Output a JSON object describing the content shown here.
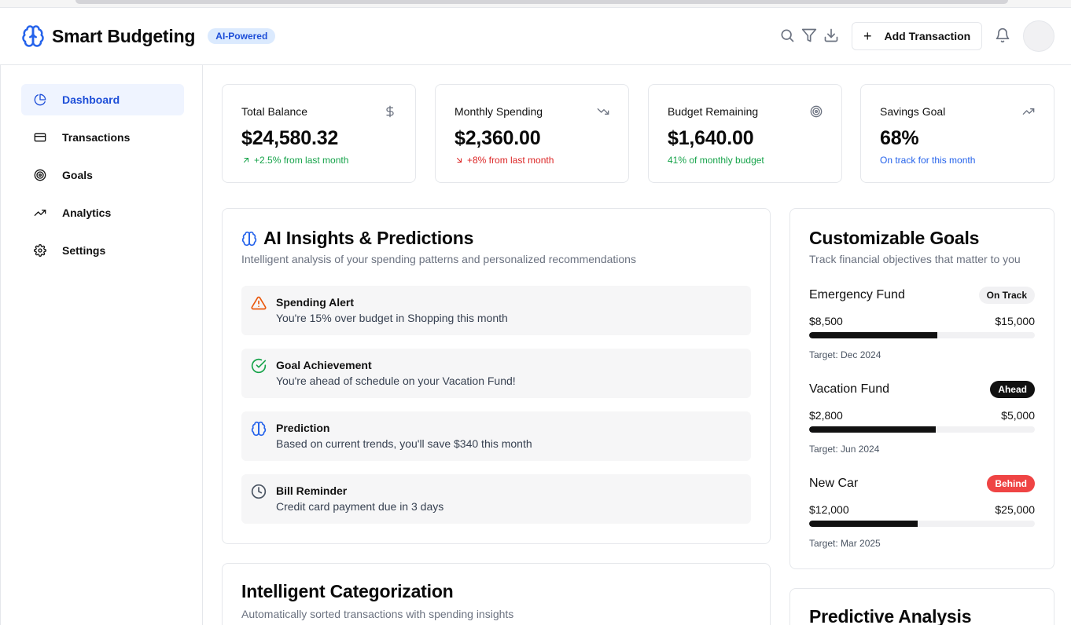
{
  "header": {
    "app_title": "Smart Budgeting",
    "badge": "AI-Powered",
    "add_transaction": "Add Transaction",
    "icons": [
      "brain-icon",
      "search-icon",
      "filter-icon",
      "download-icon",
      "plus-icon",
      "bell-icon"
    ]
  },
  "sidebar": {
    "items": [
      {
        "label": "Dashboard",
        "icon": "pie-chart-icon",
        "active": true
      },
      {
        "label": "Transactions",
        "icon": "credit-card-icon",
        "active": false
      },
      {
        "label": "Goals",
        "icon": "target-icon",
        "active": false
      },
      {
        "label": "Analytics",
        "icon": "trending-up-icon",
        "active": false
      },
      {
        "label": "Settings",
        "icon": "gear-icon",
        "active": false
      }
    ]
  },
  "stats": [
    {
      "label": "Total Balance",
      "value": "$24,580.32",
      "sub": "+2.5% from last month",
      "icon": "dollar-icon",
      "tone": "green"
    },
    {
      "label": "Monthly Spending",
      "value": "$2,360.00",
      "sub": "+8% from last month",
      "icon": "trending-down-icon",
      "tone": "red"
    },
    {
      "label": "Budget Remaining",
      "value": "$1,640.00",
      "sub": "41% of monthly budget",
      "icon": "target-icon",
      "tone": "green"
    },
    {
      "label": "Savings Goal",
      "value": "68%",
      "sub": "On track for this month",
      "icon": "trending-up-icon",
      "tone": "blue"
    }
  ],
  "insights": {
    "title": "AI Insights & Predictions",
    "description": "Intelligent analysis of your spending patterns and personalized recommendations",
    "items": [
      {
        "title": "Spending Alert",
        "text": "You're 15% over budget in Shopping this month",
        "icon": "warning-icon",
        "color": "#ea580c"
      },
      {
        "title": "Goal Achievement",
        "text": "You're ahead of schedule on your Vacation Fund!",
        "icon": "check-circle-icon",
        "color": "#16a34a"
      },
      {
        "title": "Prediction",
        "text": "Based on current trends, you'll save $340 this month",
        "icon": "brain-icon",
        "color": "#2563eb"
      },
      {
        "title": "Bill Reminder",
        "text": "Credit card payment due in 3 days",
        "icon": "clock-icon",
        "color": "#4b5563"
      }
    ]
  },
  "goals": {
    "title": "Customizable Goals",
    "description": "Track financial objectives that matter to you",
    "items": [
      {
        "name": "Emergency Fund",
        "status": "On Track",
        "current": "$8,500",
        "target": "$15,000",
        "progress": 0.567,
        "date": "Target: Dec 2024"
      },
      {
        "name": "Vacation Fund",
        "status": "Ahead",
        "current": "$2,800",
        "target": "$5,000",
        "progress": 0.56,
        "date": "Target: Jun 2024"
      },
      {
        "name": "New Car",
        "status": "Behind",
        "current": "$12,000",
        "target": "$25,000",
        "progress": 0.48,
        "date": "Target: Mar 2025"
      }
    ]
  },
  "categorization": {
    "title": "Intelligent Categorization",
    "description": "Automatically sorted transactions with spending insights"
  },
  "predictive": {
    "title": "Predictive Analysis"
  },
  "colors": {
    "accent": "#2563eb",
    "active_bg": "#eff4ff",
    "positive": "#16a34a",
    "negative": "#dc2626",
    "warning": "#ea580c",
    "behind": "#ef4444"
  }
}
